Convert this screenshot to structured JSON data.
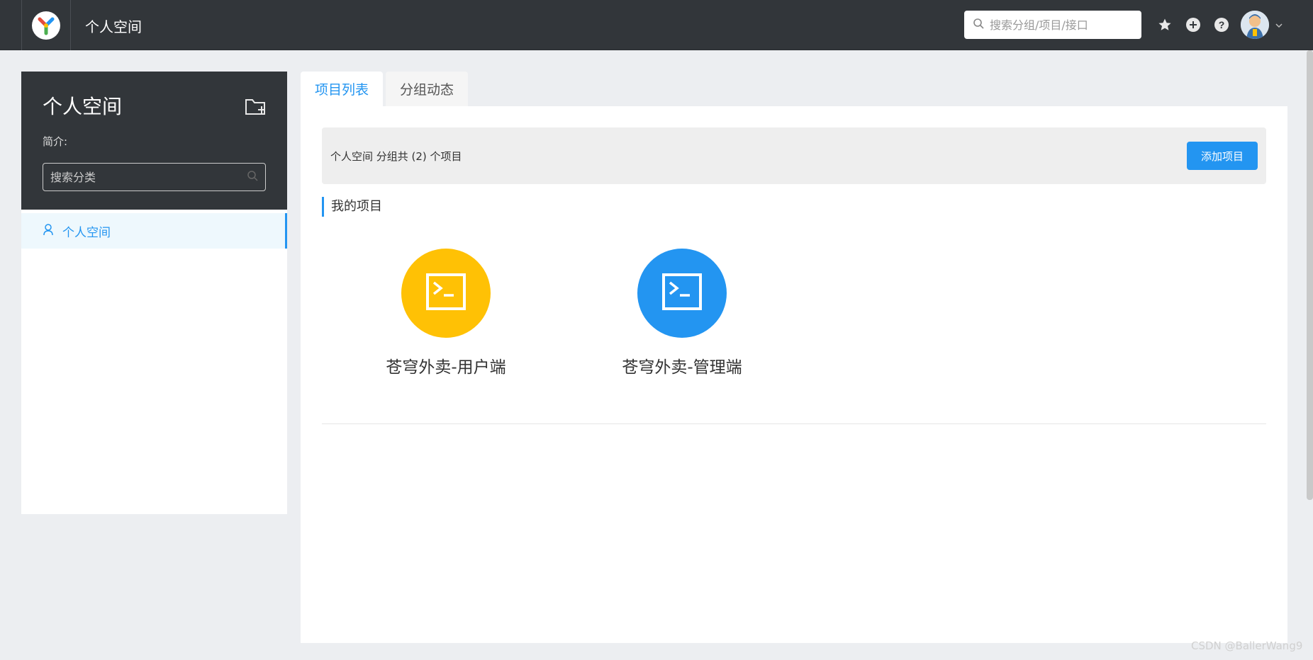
{
  "header": {
    "title": "个人空间",
    "search_placeholder": "搜索分组/项目/接口",
    "icons": [
      "star-icon",
      "plus-circle-icon",
      "help-icon"
    ],
    "avatar": "user-avatar"
  },
  "sidebar": {
    "title": "个人空间",
    "intro_label": "简介:",
    "search_placeholder": "搜索分类",
    "items": [
      {
        "label": "个人空间",
        "icon": "user-icon",
        "active": true
      }
    ]
  },
  "tabs": [
    {
      "label": "项目列表",
      "active": true
    },
    {
      "label": "分组动态",
      "active": false
    }
  ],
  "main": {
    "info_text": "个人空间 分组共 (2) 个项目",
    "add_button": "添加项目",
    "section_title": "我的项目",
    "projects": [
      {
        "name": "苍穹外卖-用户端",
        "color": "#ffc105",
        "icon": "terminal-icon"
      },
      {
        "name": "苍穹外卖-管理端",
        "color": "#2395f1",
        "icon": "terminal-icon"
      }
    ]
  },
  "colors": {
    "header_bg": "#32363a",
    "accent": "#2395f1",
    "page_bg": "#eceef1"
  },
  "watermark": "CSDN @BallerWang9"
}
